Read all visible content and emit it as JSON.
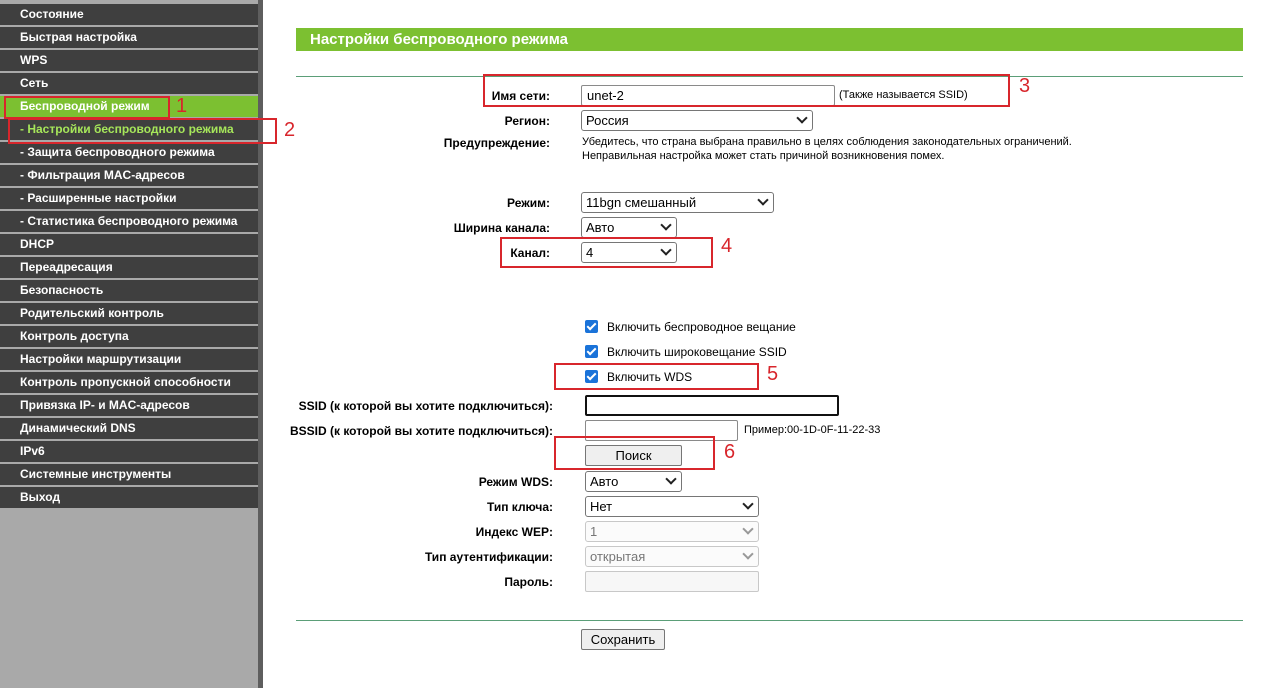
{
  "sidebar": {
    "items": [
      {
        "label": "Состояние",
        "type": "main"
      },
      {
        "label": "Быстрая настройка",
        "type": "main"
      },
      {
        "label": "WPS",
        "type": "main"
      },
      {
        "label": "Сеть",
        "type": "main"
      },
      {
        "label": "Беспроводной режим",
        "type": "active"
      },
      {
        "label": "- Настройки беспроводного режима",
        "type": "sub-active"
      },
      {
        "label": "- Защита беспроводного режима",
        "type": "sub"
      },
      {
        "label": "- Фильтрация MAC-адресов",
        "type": "sub"
      },
      {
        "label": "- Расширенные настройки",
        "type": "sub"
      },
      {
        "label": "- Статистика беспроводного режима",
        "type": "sub"
      },
      {
        "label": "DHCP",
        "type": "main"
      },
      {
        "label": "Переадресация",
        "type": "main"
      },
      {
        "label": "Безопасность",
        "type": "main"
      },
      {
        "label": "Родительский контроль",
        "type": "main"
      },
      {
        "label": "Контроль доступа",
        "type": "main"
      },
      {
        "label": "Настройки маршрутизации",
        "type": "main"
      },
      {
        "label": "Контроль пропускной способности",
        "type": "main"
      },
      {
        "label": "Привязка IP- и MAC-адресов",
        "type": "main"
      },
      {
        "label": "Динамический DNS",
        "type": "main"
      },
      {
        "label": "IPv6",
        "type": "main"
      },
      {
        "label": "Системные инструменты",
        "type": "main"
      },
      {
        "label": "Выход",
        "type": "main"
      }
    ]
  },
  "page": {
    "title": "Настройки беспроводного режима"
  },
  "form": {
    "ssid_label": "Имя сети:",
    "ssid_value": "unet-2",
    "ssid_note": "(Также называется SSID)",
    "region_label": "Регион:",
    "region_value": "Россия",
    "warning_label": "Предупреждение:",
    "warning_line1": "Убедитесь, что страна выбрана правильно в целях соблюдения законодательных ограничений.",
    "warning_line2": "Неправильная настройка может стать причиной возникновения помех.",
    "mode_label": "Режим:",
    "mode_value": "11bgn смешанный",
    "width_label": "Ширина канала:",
    "width_value": "Авто",
    "channel_label": "Канал:",
    "channel_value": "4",
    "enable_broadcast": "Включить беспроводное вещание",
    "enable_ssid_broadcast": "Включить широковещание SSID",
    "enable_wds": "Включить WDS",
    "wds_ssid_label": "SSID (к которой вы хотите подключиться):",
    "wds_ssid_value": "",
    "wds_bssid_label": "BSSID (к которой вы хотите подключиться):",
    "wds_bssid_value": "",
    "bssid_example": "Пример:00-1D-0F-11-22-33",
    "search_button": "Поиск",
    "wds_mode_label": "Режим WDS:",
    "wds_mode_value": "Авто",
    "key_type_label": "Тип ключа:",
    "key_type_value": "Нет",
    "wep_index_label": "Индекс WEP:",
    "wep_index_value": "1",
    "auth_type_label": "Тип аутентификации:",
    "auth_type_value": "открытая",
    "password_label": "Пароль:",
    "password_value": "",
    "save_button": "Сохранить"
  },
  "annotations": {
    "n1": "1",
    "n2": "2",
    "n3": "3",
    "n4": "4",
    "n5": "5",
    "n6": "6",
    "color": "#d8262c"
  },
  "colors": {
    "accent_green": "#7cc031",
    "sidebar_item": "#3f3f3f",
    "sidebar_bg": "#a9a9a9",
    "checkbox_blue": "#1a73d9"
  }
}
